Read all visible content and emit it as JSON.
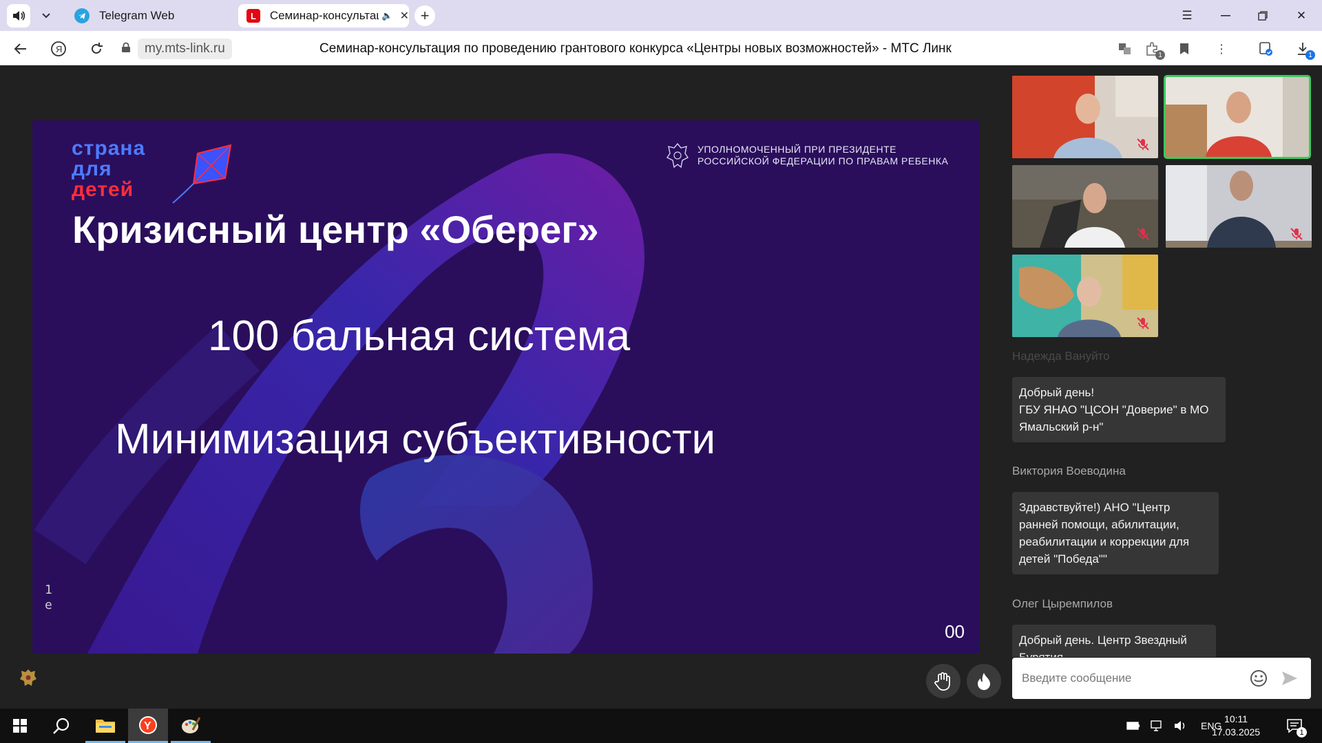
{
  "browser": {
    "tabs": [
      {
        "title": "Telegram Web"
      },
      {
        "title": "Семинар-консультация"
      }
    ],
    "url": "my.mts-link.ru",
    "page_title": "Семинар-консультация по проведению грантового конкурса «Центры новых возможностей» - МТС Линк",
    "extensions_badge": "1",
    "downloads_badge": "1"
  },
  "slide": {
    "logo": [
      "страна",
      "для",
      "детей"
    ],
    "ombudsman": [
      "УПОЛНОМОЧЕННЫЙ ПРИ ПРЕЗИДЕНТЕ",
      "РОССИЙСКОЙ ФЕДЕРАЦИИ ПО ПРАВАМ РЕБЕНКА"
    ],
    "title": "Кризисный центр «Оберег»",
    "line1": "100 бальная система",
    "line2": "Минимизация субъективности",
    "side_text": [
      "1",
      "е"
    ],
    "number": "00",
    "colors": {
      "background": "#2a0e5c",
      "logo_blue": "#4d7bff",
      "logo_red": "#ff2d3c"
    }
  },
  "videos": [
    {
      "id": "p1",
      "muted": true,
      "speaking": false
    },
    {
      "id": "p2",
      "muted": false,
      "speaking": true
    },
    {
      "id": "p3",
      "muted": true,
      "speaking": false
    },
    {
      "id": "p4",
      "muted": true,
      "speaking": false
    },
    {
      "id": "p5",
      "muted": true,
      "speaking": false
    }
  ],
  "chat": {
    "messages": [
      {
        "author": "Надежда Вануйто",
        "text": [
          "Добрый день!",
          "ГБУ ЯНАО \"ЦСОН \"Доверие\" в МО",
          "Ямальский р-н\""
        ]
      },
      {
        "author": "Виктория Воеводина",
        "text": [
          "Здравствуйте!) АНО \"Центр",
          "ранней помощи, абилитации,",
          "реабилитации и коррекции для",
          "детей \"Победа\"\""
        ]
      },
      {
        "author": "Олег Цыремпилов",
        "text": [
          "Добрый день. Центр Звездный",
          "Бурятия"
        ]
      }
    ],
    "input_placeholder": "Введите сообщение"
  },
  "taskbar": {
    "lang": "ENG",
    "time": "10:11",
    "date": "17.03.2025",
    "notifications": "1"
  }
}
